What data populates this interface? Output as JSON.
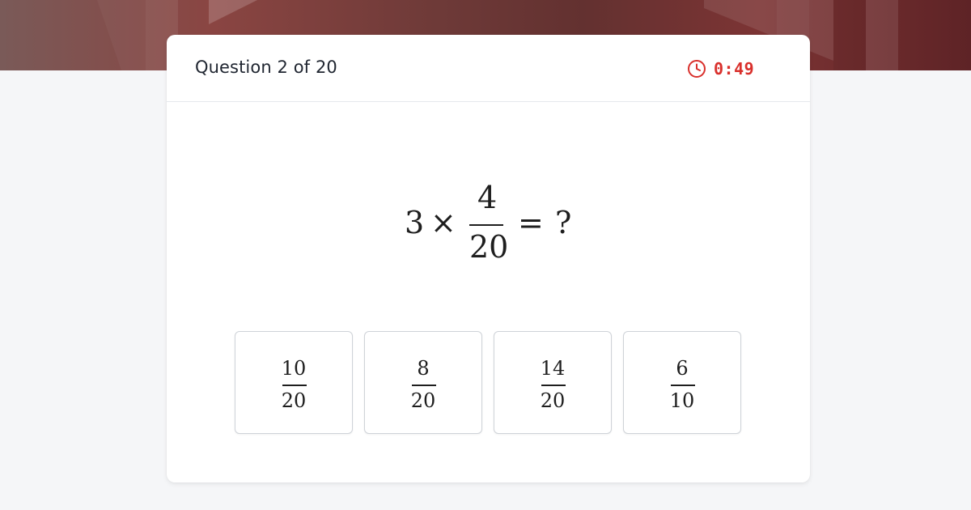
{
  "header": {
    "question_counter": "Question 2 of 20",
    "timer": "0:49",
    "timer_icon": "clock-icon"
  },
  "question": {
    "multiplier": "3",
    "operator": "×",
    "numerator": "4",
    "denominator": "20",
    "equals": "=",
    "unknown": "?"
  },
  "options": [
    {
      "numerator": "10",
      "denominator": "20"
    },
    {
      "numerator": "8",
      "denominator": "20"
    },
    {
      "numerator": "14",
      "denominator": "20"
    },
    {
      "numerator": "6",
      "denominator": "10"
    }
  ],
  "colors": {
    "timer_accent": "#d9302c",
    "banner_dark": "#5e2326",
    "page_background": "#f5f6f8"
  }
}
